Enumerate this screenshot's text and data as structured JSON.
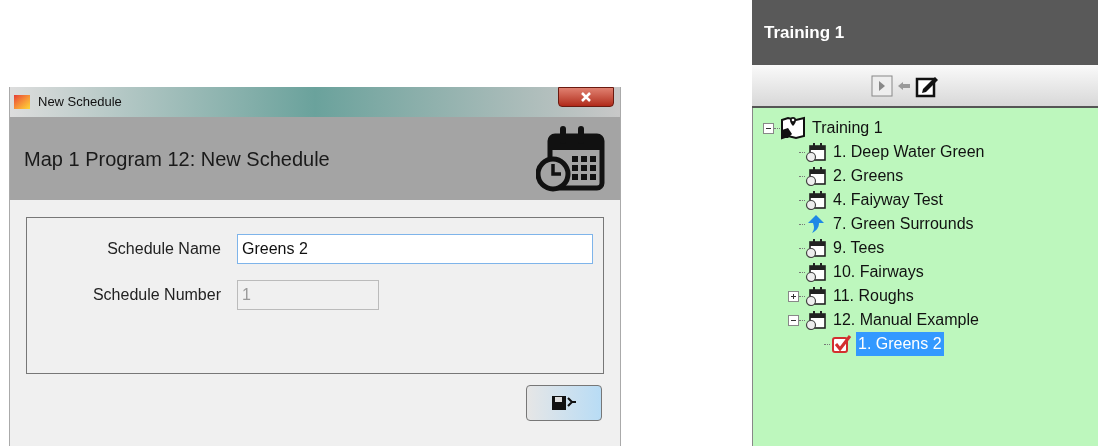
{
  "dialog": {
    "title": "New Schedule",
    "heading": "Map 1 Program 12: New Schedule",
    "fields": [
      {
        "label": "Schedule Name",
        "value": "Greens 2",
        "disabled": false,
        "focused": true
      },
      {
        "label": "Schedule Number",
        "value": "1",
        "disabled": true,
        "focused": false
      }
    ]
  },
  "panel": {
    "title": "Training 1",
    "tree": [
      {
        "label": "Training 1",
        "kind": "map",
        "expanded": true,
        "selected": false,
        "children": [
          {
            "label": "1. Deep Water Green",
            "kind": "schedule",
            "selected": false
          },
          {
            "label": "2. Greens",
            "kind": "schedule",
            "selected": false
          },
          {
            "label": "4. Faiyway Test",
            "kind": "schedule",
            "selected": false
          },
          {
            "label": "7. Green Surrounds",
            "kind": "program",
            "selected": false
          },
          {
            "label": "9. Tees",
            "kind": "schedule",
            "selected": false
          },
          {
            "label": "10. Fairways",
            "kind": "schedule",
            "selected": false
          },
          {
            "label": "11. Roughs",
            "kind": "schedule",
            "expanded": false,
            "selected": false
          },
          {
            "label": "12. Manual Example",
            "kind": "schedule",
            "expanded": true,
            "selected": false,
            "children": [
              {
                "label": "1. Greens 2",
                "kind": "manual",
                "selected": true
              }
            ]
          }
        ]
      }
    ]
  }
}
